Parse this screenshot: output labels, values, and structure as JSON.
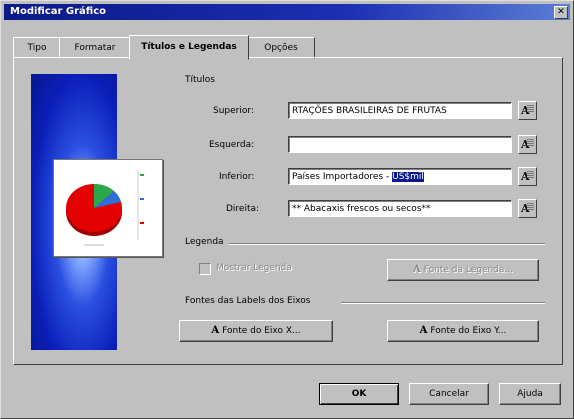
{
  "window": {
    "title": "Modificar Gráfico",
    "close_glyph": "✕"
  },
  "tabs": [
    {
      "label": "Tipo"
    },
    {
      "label": "Formatar"
    },
    {
      "label": "Títulos e Legendas"
    },
    {
      "label": "Opções"
    }
  ],
  "titles": {
    "group_label": "Títulos",
    "superior": {
      "label": "Superior:",
      "value": "RTAÇÕES BRASILEIRAS DE FRUTAS"
    },
    "esquerda": {
      "label": "Esquerda:",
      "value": ""
    },
    "inferior": {
      "label": "Inferior:",
      "value_plain": "Países Importadores - ",
      "value_selected": "US$mil"
    },
    "direita": {
      "label": "Direita:",
      "value": "** Abacaxis frescos ou secos**"
    }
  },
  "legend": {
    "group_label": "Legenda",
    "show_label": "Mostrar Legenda",
    "show_checked": false,
    "font_button": "Fonte da Legenda..."
  },
  "axes": {
    "group_label": "Fontes das Labels dos Eixos",
    "x_button": "Fonte do Eixo X...",
    "y_button": "Fonte do Eixo Y..."
  },
  "footer": {
    "ok": "OK",
    "cancel": "Cancelar",
    "help": "Ajuda"
  },
  "icons": {
    "font_icon": "font-A-icon"
  },
  "colors": {
    "titlebar": "#0b1a88",
    "pie_red": "#e30000",
    "pie_green": "#2aa84a",
    "pie_blue": "#2f6fd8"
  }
}
